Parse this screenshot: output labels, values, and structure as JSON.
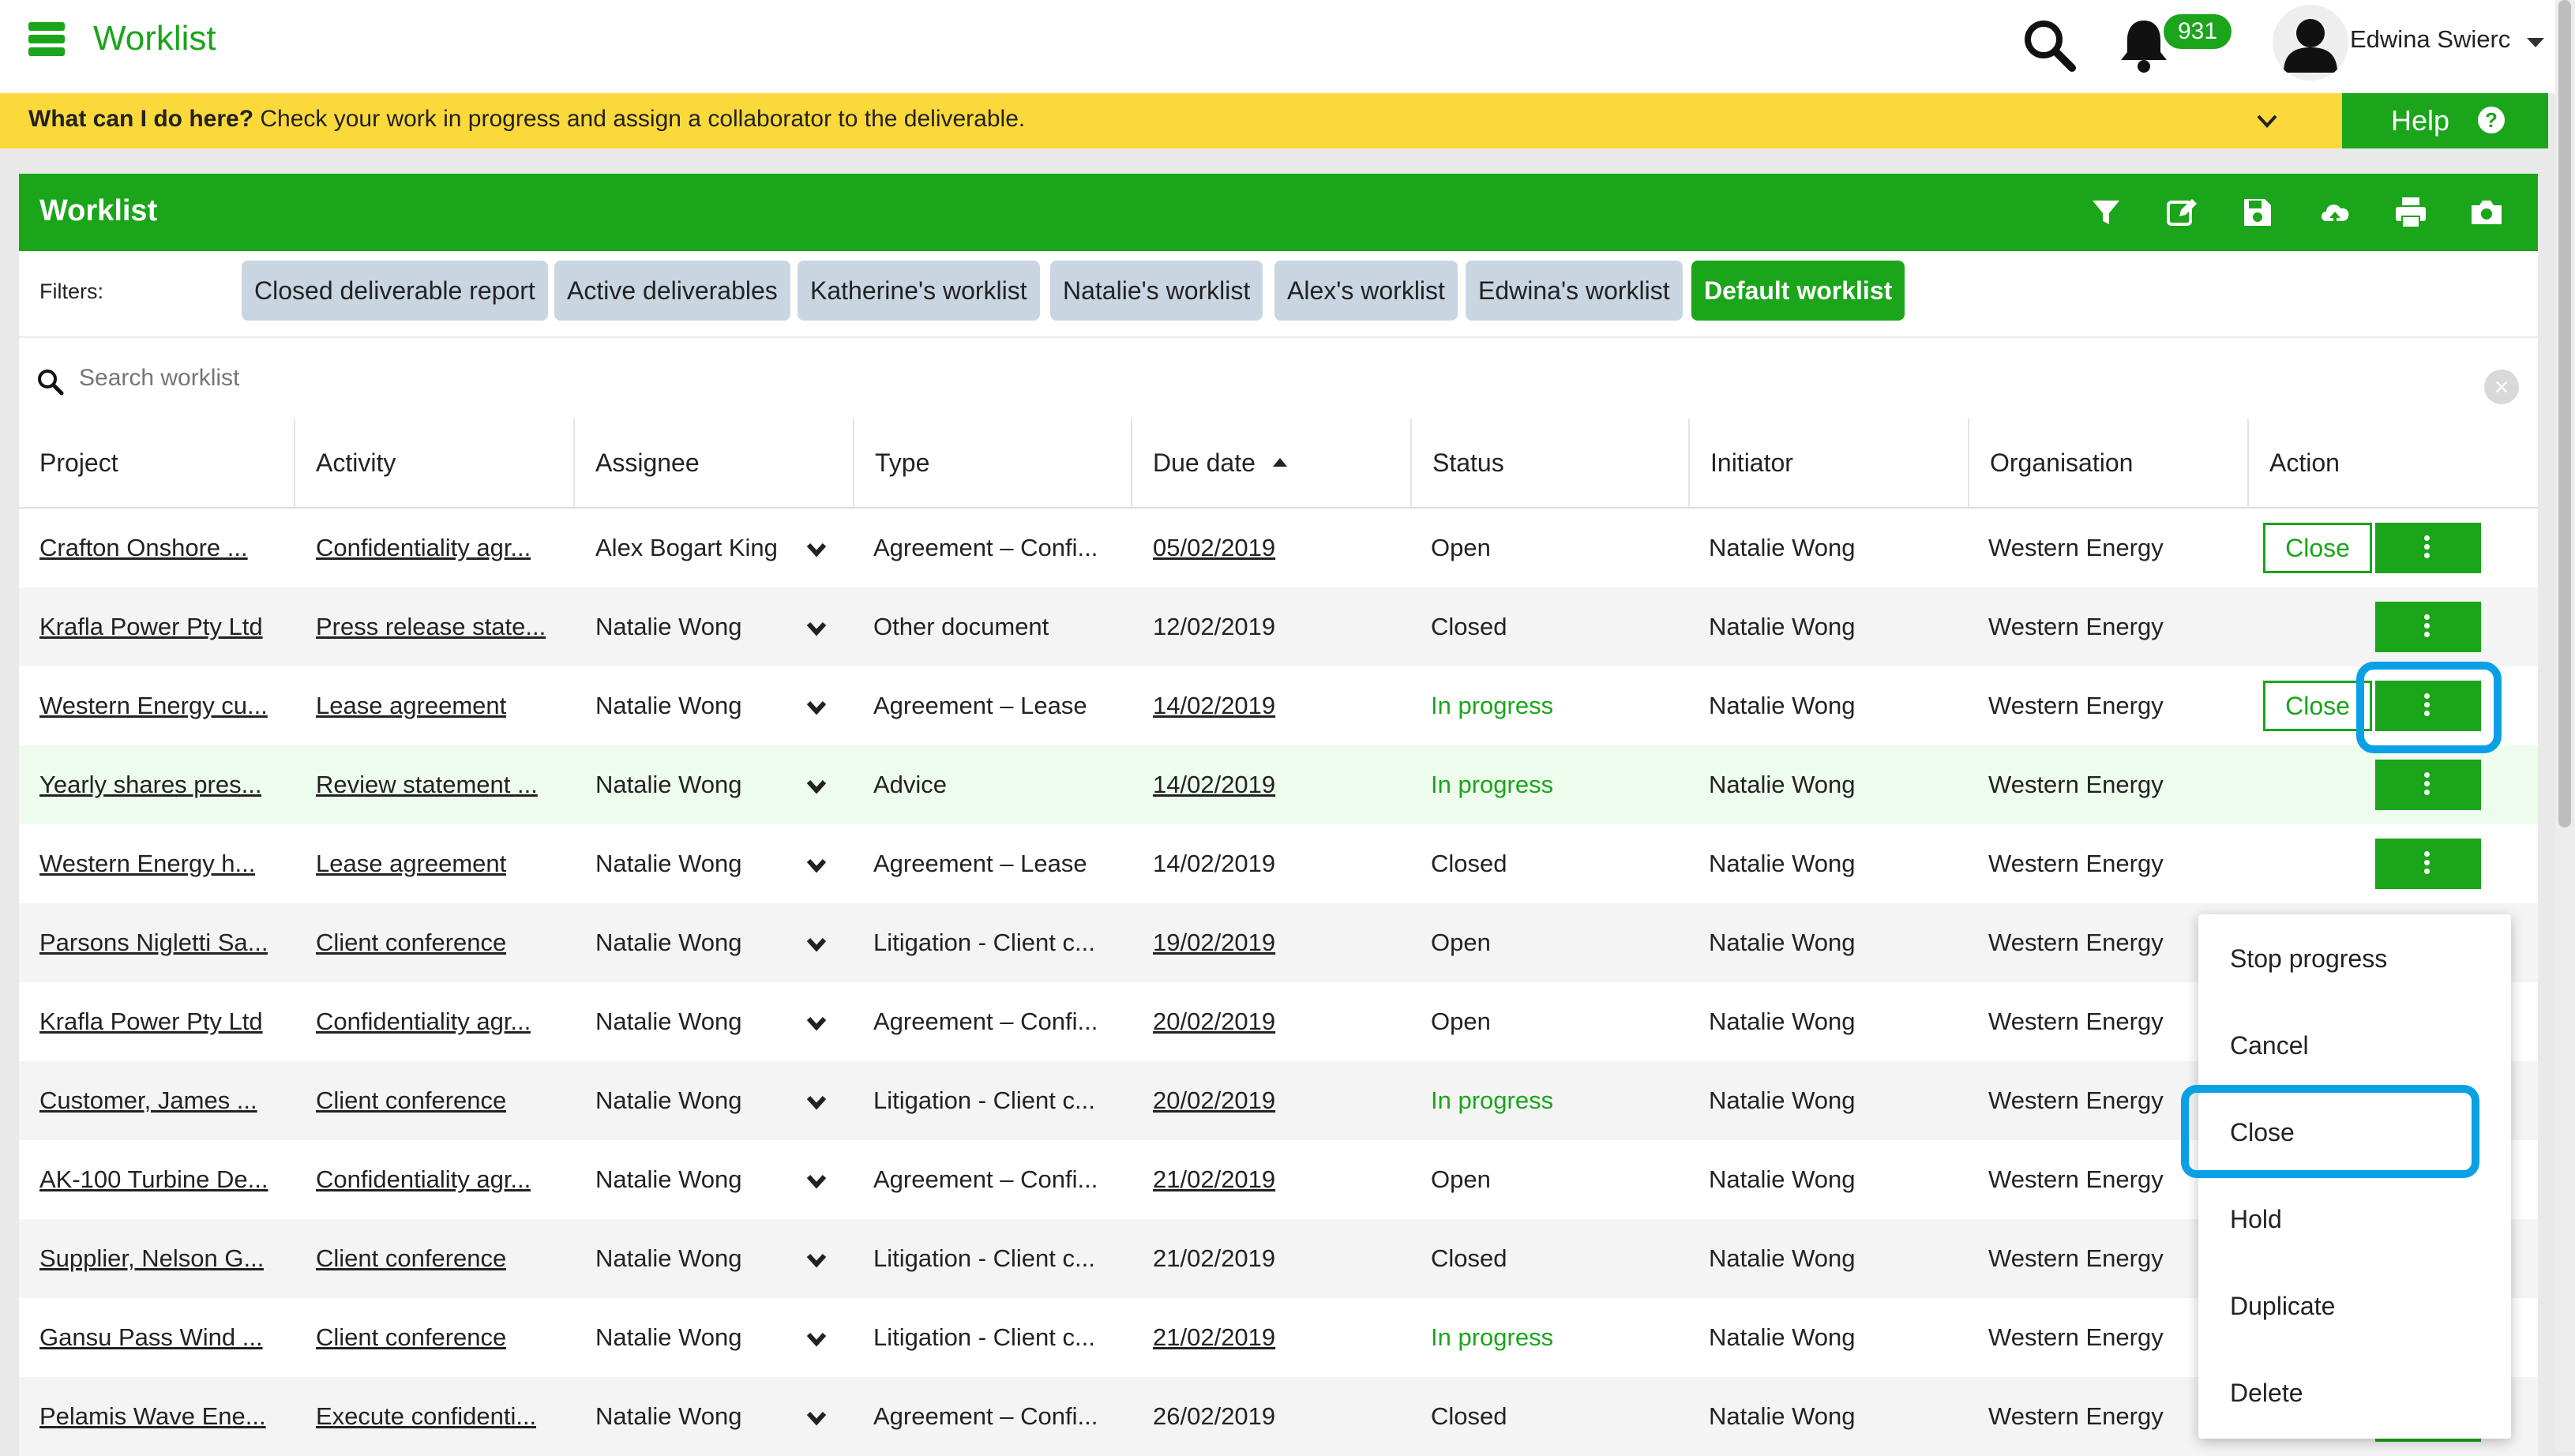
{
  "app": {
    "title": "Worklist",
    "notifications_count": "931",
    "user_name": "Edwina Swierc"
  },
  "banner": {
    "question": "What can I do here?",
    "text": "Check your work in progress and assign a collaborator to the deliverable.",
    "help_label": "Help"
  },
  "panel": {
    "title": "Worklist",
    "toolbar_icons": [
      "filter-icon",
      "edit-icon",
      "save-icon",
      "upload-icon",
      "print-icon",
      "camera-icon"
    ],
    "filters_label": "Filters:",
    "filters": [
      {
        "label": "Closed deliverable report",
        "active": false
      },
      {
        "label": "Active deliverables",
        "active": false
      },
      {
        "label": "Katherine's worklist",
        "active": false
      },
      {
        "label": "Natalie's worklist",
        "active": false
      },
      {
        "label": "Alex's worklist",
        "active": false
      },
      {
        "label": "Edwina's worklist",
        "active": false
      },
      {
        "label": "Default worklist",
        "active": true
      }
    ],
    "search_placeholder": "Search worklist"
  },
  "table": {
    "columns": [
      "Project",
      "Activity",
      "Assignee",
      "Type",
      "Due date",
      "Status",
      "Initiator",
      "Organisation",
      "Action"
    ],
    "rows": [
      {
        "project": "Crafton Onshore ...",
        "activity": "Confidentiality agr...",
        "assignee": "Alex Bogart King",
        "type": "Agreement – Confi...",
        "due": "05/02/2019",
        "due_underlined": true,
        "status": "Open",
        "initiator": "Natalie Wong",
        "org": "Western Energy",
        "close_btn": true
      },
      {
        "project": "Krafla Power Pty Ltd",
        "activity": "Press release state...",
        "assignee": "Natalie Wong",
        "type": "Other document",
        "due": "12/02/2019",
        "due_underlined": false,
        "status": "Closed",
        "initiator": "Natalie Wong",
        "org": "Western Energy",
        "close_btn": false
      },
      {
        "project": "Western Energy cu...",
        "activity": "Lease agreement",
        "assignee": "Natalie Wong",
        "type": "Agreement – Lease",
        "due": "14/02/2019",
        "due_underlined": true,
        "status": "In progress",
        "initiator": "Natalie Wong",
        "org": "Western Energy",
        "close_btn": true
      },
      {
        "project": "Yearly shares pres...",
        "activity": "Review statement ...",
        "assignee": "Natalie Wong",
        "type": "Advice",
        "due": "14/02/2019",
        "due_underlined": true,
        "status": "In progress",
        "initiator": "Natalie Wong",
        "org": "Western Energy",
        "close_btn": false
      },
      {
        "project": "Western Energy h...",
        "activity": "Lease agreement",
        "assignee": "Natalie Wong",
        "type": "Agreement – Lease",
        "due": "14/02/2019",
        "due_underlined": false,
        "status": "Closed",
        "initiator": "Natalie Wong",
        "org": "Western Energy",
        "close_btn": false
      },
      {
        "project": "Parsons Nigletti Sa...",
        "activity": "Client conference",
        "assignee": "Natalie Wong",
        "type": "Litigation - Client c...",
        "due": "19/02/2019",
        "due_underlined": true,
        "status": "Open",
        "initiator": "Natalie Wong",
        "org": "Western Energy",
        "close_btn": false
      },
      {
        "project": "Krafla Power Pty Ltd",
        "activity": "Confidentiality agr...",
        "assignee": "Natalie Wong",
        "type": "Agreement – Confi...",
        "due": "20/02/2019",
        "due_underlined": true,
        "status": "Open",
        "initiator": "Natalie Wong",
        "org": "Western Energy",
        "close_btn": false
      },
      {
        "project": "Customer, James ...",
        "activity": "Client conference",
        "assignee": "Natalie Wong",
        "type": "Litigation - Client c...",
        "due": "20/02/2019",
        "due_underlined": true,
        "status": "In progress",
        "initiator": "Natalie Wong",
        "org": "Western Energy",
        "close_btn": false
      },
      {
        "project": "AK-100 Turbine De...",
        "activity": "Confidentiality agr...",
        "assignee": "Natalie Wong",
        "type": "Agreement – Confi...",
        "due": "21/02/2019",
        "due_underlined": true,
        "status": "Open",
        "initiator": "Natalie Wong",
        "org": "Western Energy",
        "close_btn": false
      },
      {
        "project": "Supplier, Nelson G...",
        "activity": "Client conference",
        "assignee": "Natalie Wong",
        "type": "Litigation - Client c...",
        "due": "21/02/2019",
        "due_underlined": false,
        "status": "Closed",
        "initiator": "Natalie Wong",
        "org": "Western Energy",
        "close_btn": false
      },
      {
        "project": "Gansu Pass Wind ...",
        "activity": "Client conference",
        "assignee": "Natalie Wong",
        "type": "Litigation - Client c...",
        "due": "21/02/2019",
        "due_underlined": true,
        "status": "In progress",
        "initiator": "Natalie Wong",
        "org": "Western Energy",
        "close_btn": true
      },
      {
        "project": "Pelamis Wave Ene...",
        "activity": "Execute confidenti...",
        "assignee": "Natalie Wong",
        "type": "Agreement – Confi...",
        "due": "26/02/2019",
        "due_underlined": false,
        "status": "Closed",
        "initiator": "Natalie Wong",
        "org": "Western Energy",
        "close_btn": false
      }
    ],
    "close_label": "Close"
  },
  "action_menu": {
    "items": [
      "Stop progress",
      "Cancel",
      "Close",
      "Hold",
      "Duplicate",
      "Delete"
    ],
    "highlighted": "Duplicate"
  },
  "colors": {
    "brand_green": "#1aa51a",
    "banner_yellow": "#fcd93a",
    "focus_blue": "#0aa0e6"
  }
}
